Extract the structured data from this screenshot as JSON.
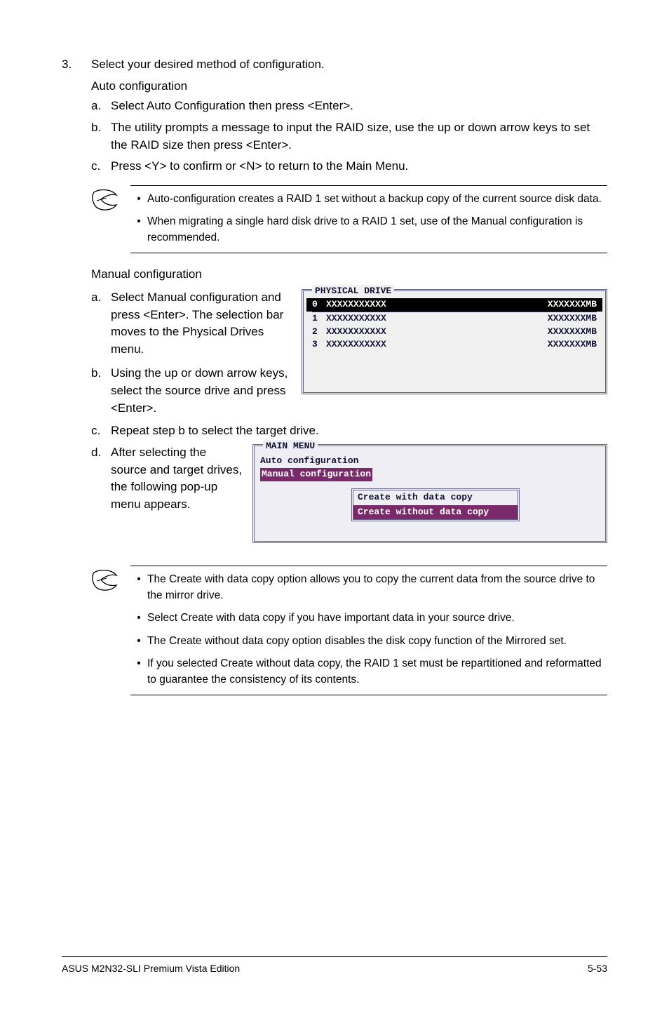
{
  "step3": {
    "number": "3.",
    "text": "Select your desired method of configuration.",
    "autoHeading": "Auto configuration",
    "a": {
      "l": "a.",
      "t": "Select Auto Configuration then press <Enter>."
    },
    "b": {
      "l": "b.",
      "t": "The utility prompts a message to input the RAID size, use the up or down arrow keys to set the RAID size then press <Enter>."
    },
    "c": {
      "l": "c.",
      "t": "Press <Y> to confirm or <N> to return to the Main Menu."
    }
  },
  "note1": {
    "b1": "Auto-configuration creates a RAID 1 set without a backup copy of the current source disk data.",
    "b2": "When migrating a single hard disk drive to a RAID 1 set, use of the Manual configuration is recommended."
  },
  "manualHeading": "Manual configuration",
  "ma": {
    "l": "a.",
    "t": "Select Manual configuration and press <Enter>. The selection bar moves to the Physical Drives menu."
  },
  "mb": {
    "l": "b.",
    "t": "Using the up or down arrow keys, select the source drive and press <Enter>."
  },
  "mc": {
    "l": "c.",
    "t": "Repeat step b to select the target drive."
  },
  "md": {
    "l": "d.",
    "t": "After selecting the source and target drives, the following pop-up menu appears."
  },
  "phys": {
    "title": "PHYSICAL DRIVE",
    "rows": [
      {
        "n": "0",
        "id": "XXXXXXXXXXX",
        "sz": "XXXXXXXMB"
      },
      {
        "n": "1",
        "id": "XXXXXXXXXXX",
        "sz": "XXXXXXXMB"
      },
      {
        "n": "2",
        "id": "XXXXXXXXXXX",
        "sz": "XXXXXXXMB"
      },
      {
        "n": "3",
        "id": "XXXXXXXXXXX",
        "sz": "XXXXXXXMB"
      }
    ]
  },
  "main": {
    "title": "MAIN MENU",
    "opt1": "Auto configuration",
    "opt2": "Manual configuration",
    "pop1": "Create with data copy",
    "pop2": "Create without data copy"
  },
  "note2": {
    "b1": "The Create with data copy option allows you to copy the current data from the source drive to the mirror drive.",
    "b2": "Select Create with data copy if you have important data in your source drive.",
    "b3": "The Create without data copy option disables the disk copy function of the Mirrored set.",
    "b4": "If you selected Create without data copy, the RAID 1 set must be repartitioned and reformatted to guarantee the consistency of its contents."
  },
  "footer": {
    "left": "ASUS M2N32-SLI Premium Vista Edition",
    "right": "5-53"
  },
  "bullet": "•"
}
